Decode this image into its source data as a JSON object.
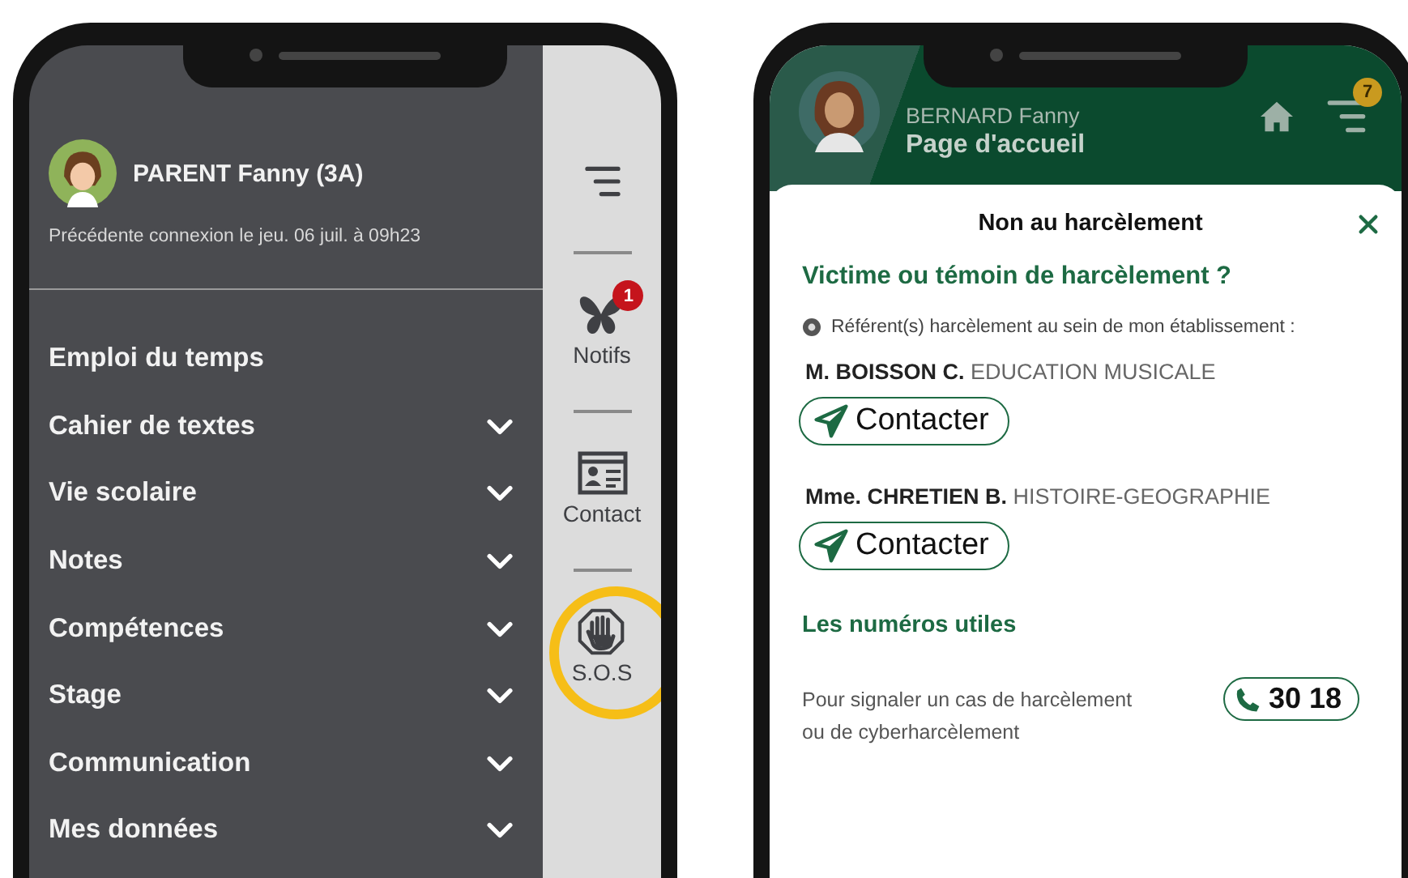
{
  "left_phone": {
    "profile": {
      "name": "PARENT Fanny (3A)",
      "last_login": "Précédente connexion le jeu. 06 juil. à 09h23"
    },
    "menu": [
      {
        "label": "Emploi du temps",
        "expandable": false
      },
      {
        "label": "Cahier de textes",
        "expandable": true
      },
      {
        "label": "Vie scolaire",
        "expandable": true
      },
      {
        "label": "Notes",
        "expandable": true
      },
      {
        "label": "Compétences",
        "expandable": true
      },
      {
        "label": "Stage",
        "expandable": true
      },
      {
        "label": "Communication",
        "expandable": true
      },
      {
        "label": "Mes données",
        "expandable": true
      }
    ],
    "rail": [
      {
        "kind": "menu"
      },
      {
        "kind": "notifs",
        "label": "Notifs",
        "badge": "1",
        "highlighted": false
      },
      {
        "kind": "contact",
        "label": "Contact",
        "highlighted": false
      },
      {
        "kind": "sos",
        "label": "S.O.S",
        "highlighted": true
      }
    ]
  },
  "right_phone": {
    "header": {
      "name": "BERNARD Fanny",
      "page": "Page d'accueil",
      "badge": "7"
    },
    "sheet": {
      "title": "Non au harcèlement",
      "heading": "Victime ou témoin de harcèlement ?",
      "info": "Référent(s) harcèlement au sein de mon établissement :",
      "referents": [
        {
          "name": "M. BOISSON C.",
          "subject": "EDUCATION MUSICALE",
          "button": "Contacter"
        },
        {
          "name": "Mme. CHRETIEN B.",
          "subject": "HISTOIRE-GEOGRAPHIE",
          "button": "Contacter"
        }
      ],
      "numbers_heading": "Les numéros utiles",
      "numbers": [
        {
          "text": "Pour signaler un cas de harcèlement ou de cyberharcèlement",
          "phone": "30 18"
        }
      ]
    }
  }
}
